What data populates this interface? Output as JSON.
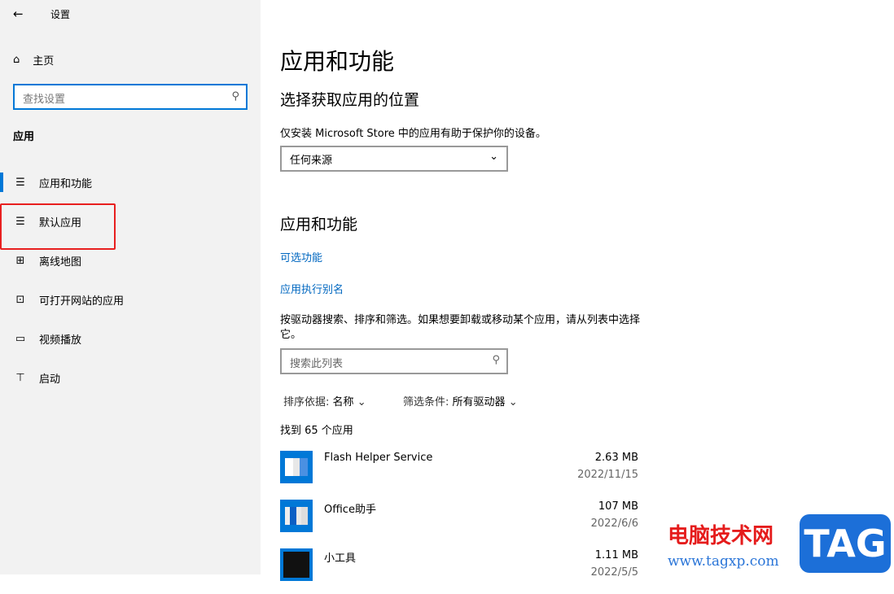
{
  "window": {
    "back_icon": "←",
    "title": "设置"
  },
  "sidebar": {
    "home": "主页",
    "search_placeholder": "查找设置",
    "section": "应用",
    "items": [
      {
        "label": "应用和功能",
        "icon": "☰"
      },
      {
        "label": "默认应用",
        "icon": "☰"
      },
      {
        "label": "离线地图",
        "icon": "⊞"
      },
      {
        "label": "可打开网站的应用",
        "icon": "⊡"
      },
      {
        "label": "视频播放",
        "icon": "▭"
      },
      {
        "label": "启动",
        "icon": "⊤"
      }
    ]
  },
  "main": {
    "title": "应用和功能",
    "source_heading": "选择获取应用的位置",
    "source_desc": "仅安装 Microsoft Store 中的应用有助于保护你的设备。",
    "source_value": "任何来源",
    "apps_heading": "应用和功能",
    "link_optional": "可选功能",
    "link_alias": "应用执行别名",
    "desc": "按驱动器搜索、排序和筛选。如果想要卸载或移动某个应用，请从列表中选择它。",
    "search_placeholder": "搜索此列表",
    "sort_label": "排序依据:",
    "sort_value": "名称",
    "filter_label": "筛选条件:",
    "filter_value": "所有驱动器",
    "count": "找到 65 个应用",
    "apps": [
      {
        "name": "Flash Helper Service",
        "size": "2.63 MB",
        "date": "2022/11/15"
      },
      {
        "name": "Office助手",
        "size": "107 MB",
        "date": "2022/6/6"
      },
      {
        "name": "小工具",
        "size": "1.11 MB",
        "date": "2022/5/5"
      }
    ]
  },
  "watermark": {
    "cn": "电脑技术网",
    "url": "www.tagxp.com",
    "tag": "TAG"
  }
}
